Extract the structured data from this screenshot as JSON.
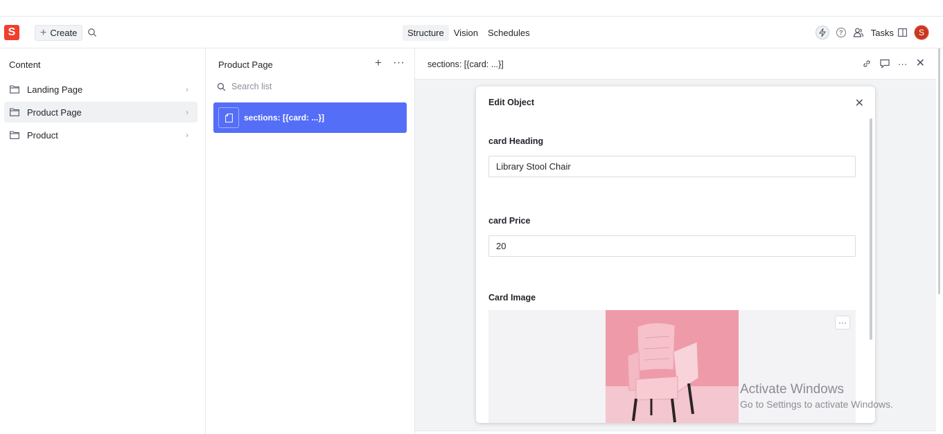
{
  "toolbar": {
    "logo_letter": "S",
    "create_label": "Create",
    "tabs": [
      "Structure",
      "Vision",
      "Schedules"
    ],
    "tasks_label": "Tasks",
    "avatar_letter": "S"
  },
  "content_pane": {
    "title": "Content",
    "items": [
      {
        "label": "Landing Page"
      },
      {
        "label": "Product Page"
      },
      {
        "label": "Product"
      }
    ]
  },
  "list_pane": {
    "title": "Product Page",
    "search_placeholder": "Search list",
    "document": "sections: [{card: ...}]"
  },
  "editor_pane": {
    "title": "sections: [{card: ...}]"
  },
  "dialog": {
    "title": "Edit Object",
    "fields": [
      {
        "label": "card Heading",
        "value": "Library Stool Chair"
      },
      {
        "label": "card Price",
        "value": "20"
      }
    ],
    "image_label": "Card Image"
  },
  "watermark": {
    "line1": "Activate Windows",
    "line2": "Go to Settings to activate Windows."
  },
  "colors": {
    "brand": "#f03e2f",
    "selected_doc": "#556ef8",
    "avatar": "#c9371f"
  }
}
